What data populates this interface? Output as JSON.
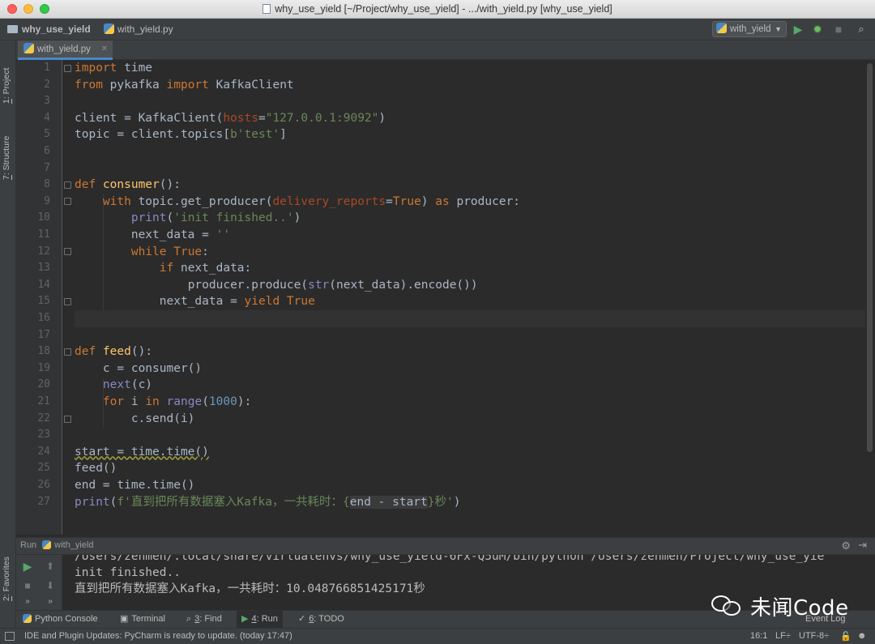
{
  "window": {
    "title": "why_use_yield [~/Project/why_use_yield] - .../with_yield.py [why_use_yield]"
  },
  "navbar": {
    "project": "why_use_yield",
    "file": "with_yield.py",
    "run_config": "with_yield"
  },
  "left_tools": {
    "project_num": "1",
    "project_label": ": Project",
    "structure_num": "7",
    "structure_label": ": Structure",
    "favorites_num": "2",
    "favorites_label": ": Favorites"
  },
  "editor": {
    "tab_label": "with_yield.py",
    "line_numbers": [
      "1",
      "2",
      "3",
      "4",
      "5",
      "6",
      "7",
      "8",
      "9",
      "10",
      "11",
      "12",
      "13",
      "14",
      "15",
      "16",
      "17",
      "18",
      "19",
      "20",
      "21",
      "22",
      "23",
      "24",
      "25",
      "26",
      "27"
    ],
    "code": {
      "l1_kw": "import",
      "l1_rest": " time",
      "l2_kw1": "from",
      "l2_mod": " pykafka ",
      "l2_kw2": "import",
      "l2_rest": " KafkaClient",
      "l4_a": "client = KafkaClient(",
      "l4_param": "hosts",
      "l4_eq": "=",
      "l4_str": "\"127.0.0.1:9092\"",
      "l4_end": ")",
      "l5_a": "topic = client.topics[",
      "l5_str": "b'test'",
      "l5_end": "]",
      "l8_kw": "def",
      "l8_fn": " consumer",
      "l8_end": "():",
      "l9_indent": "    ",
      "l9_kw": "with",
      "l9_a": " topic.get_producer(",
      "l9_param": "delivery_reports",
      "l9_eq": "=",
      "l9_kw2": "True",
      "l9_b": ") ",
      "l9_kw3": "as",
      "l9_c": " producer:",
      "l10_indent": "        ",
      "l10_fn": "print",
      "l10_a": "(",
      "l10_str": "'init finished..'",
      "l10_end": ")",
      "l11_indent": "        ",
      "l11_a": "next_data = ",
      "l11_str": "''",
      "l12_indent": "        ",
      "l12_kw": "while",
      "l12_sp": " ",
      "l12_kw2": "True",
      "l12_end": ":",
      "l13_indent": "            ",
      "l13_kw": "if",
      "l13_a": " next_data:",
      "l14_indent": "                ",
      "l14_a": "producer.produce(",
      "l14_fn": "str",
      "l14_b": "(next_data).encode())",
      "l15_indent": "            ",
      "l15_a": "next_data = ",
      "l15_kw": "yield",
      "l15_sp": " ",
      "l15_kw2": "True",
      "l18_kw": "def",
      "l18_fn": " feed",
      "l18_end": "():",
      "l19_indent": "    ",
      "l19_a": "c = consumer()",
      "l20_indent": "    ",
      "l20_fn": "next",
      "l20_a": "(c)",
      "l21_indent": "    ",
      "l21_kw": "for",
      "l21_a": " i ",
      "l21_kw2": "in",
      "l21_sp": " ",
      "l21_fn": "range",
      "l21_b": "(",
      "l21_num": "1000",
      "l21_end": "):",
      "l22_indent": "        ",
      "l22_a": "c.send(i)",
      "l24_a": "start = time.time()",
      "l25_a": "feed()",
      "l26_a": "end = time.time()",
      "l27_fn": "print",
      "l27_a": "(",
      "l27_str1": "f'直到把所有数据塞入Kafka，一共耗时：{",
      "l27_expr": "end - start",
      "l27_str2": "}秒'",
      "l27_end": ")"
    }
  },
  "run_panel": {
    "label": "Run",
    "config": "with_yield",
    "console": [
      "/Users/zenmen/.local/share/virtualenvs/why_use_yield-6Fx-Q5uM/bin/python /Users/zenmen/Project/why_use_yie",
      "init finished..",
      "直到把所有数据塞入Kafka，一共耗时：10.048766851425171秒"
    ]
  },
  "tool_tabs": {
    "python_console": "Python Console",
    "terminal": "Terminal",
    "find_num": "3",
    "find_label": ": Find",
    "run_num": "4",
    "run_label": ": Run",
    "todo_num": "6",
    "todo_label": ": TODO",
    "event_log": "Event Log"
  },
  "status": {
    "message": "IDE and Plugin Updates: PyCharm is ready to update. (today 17:47)",
    "position": "16:1",
    "line_sep": "LF÷",
    "encoding": "UTF-8÷"
  },
  "watermark": {
    "text": "未闻Code"
  },
  "colors": {
    "keyword": "#cc7832",
    "function": "#ffc66d",
    "string": "#6a8759",
    "number": "#6897bb",
    "param": "#aa4926",
    "builtin": "#8888c6",
    "text": "#a9b7c6",
    "accent": "#4a88c7"
  }
}
